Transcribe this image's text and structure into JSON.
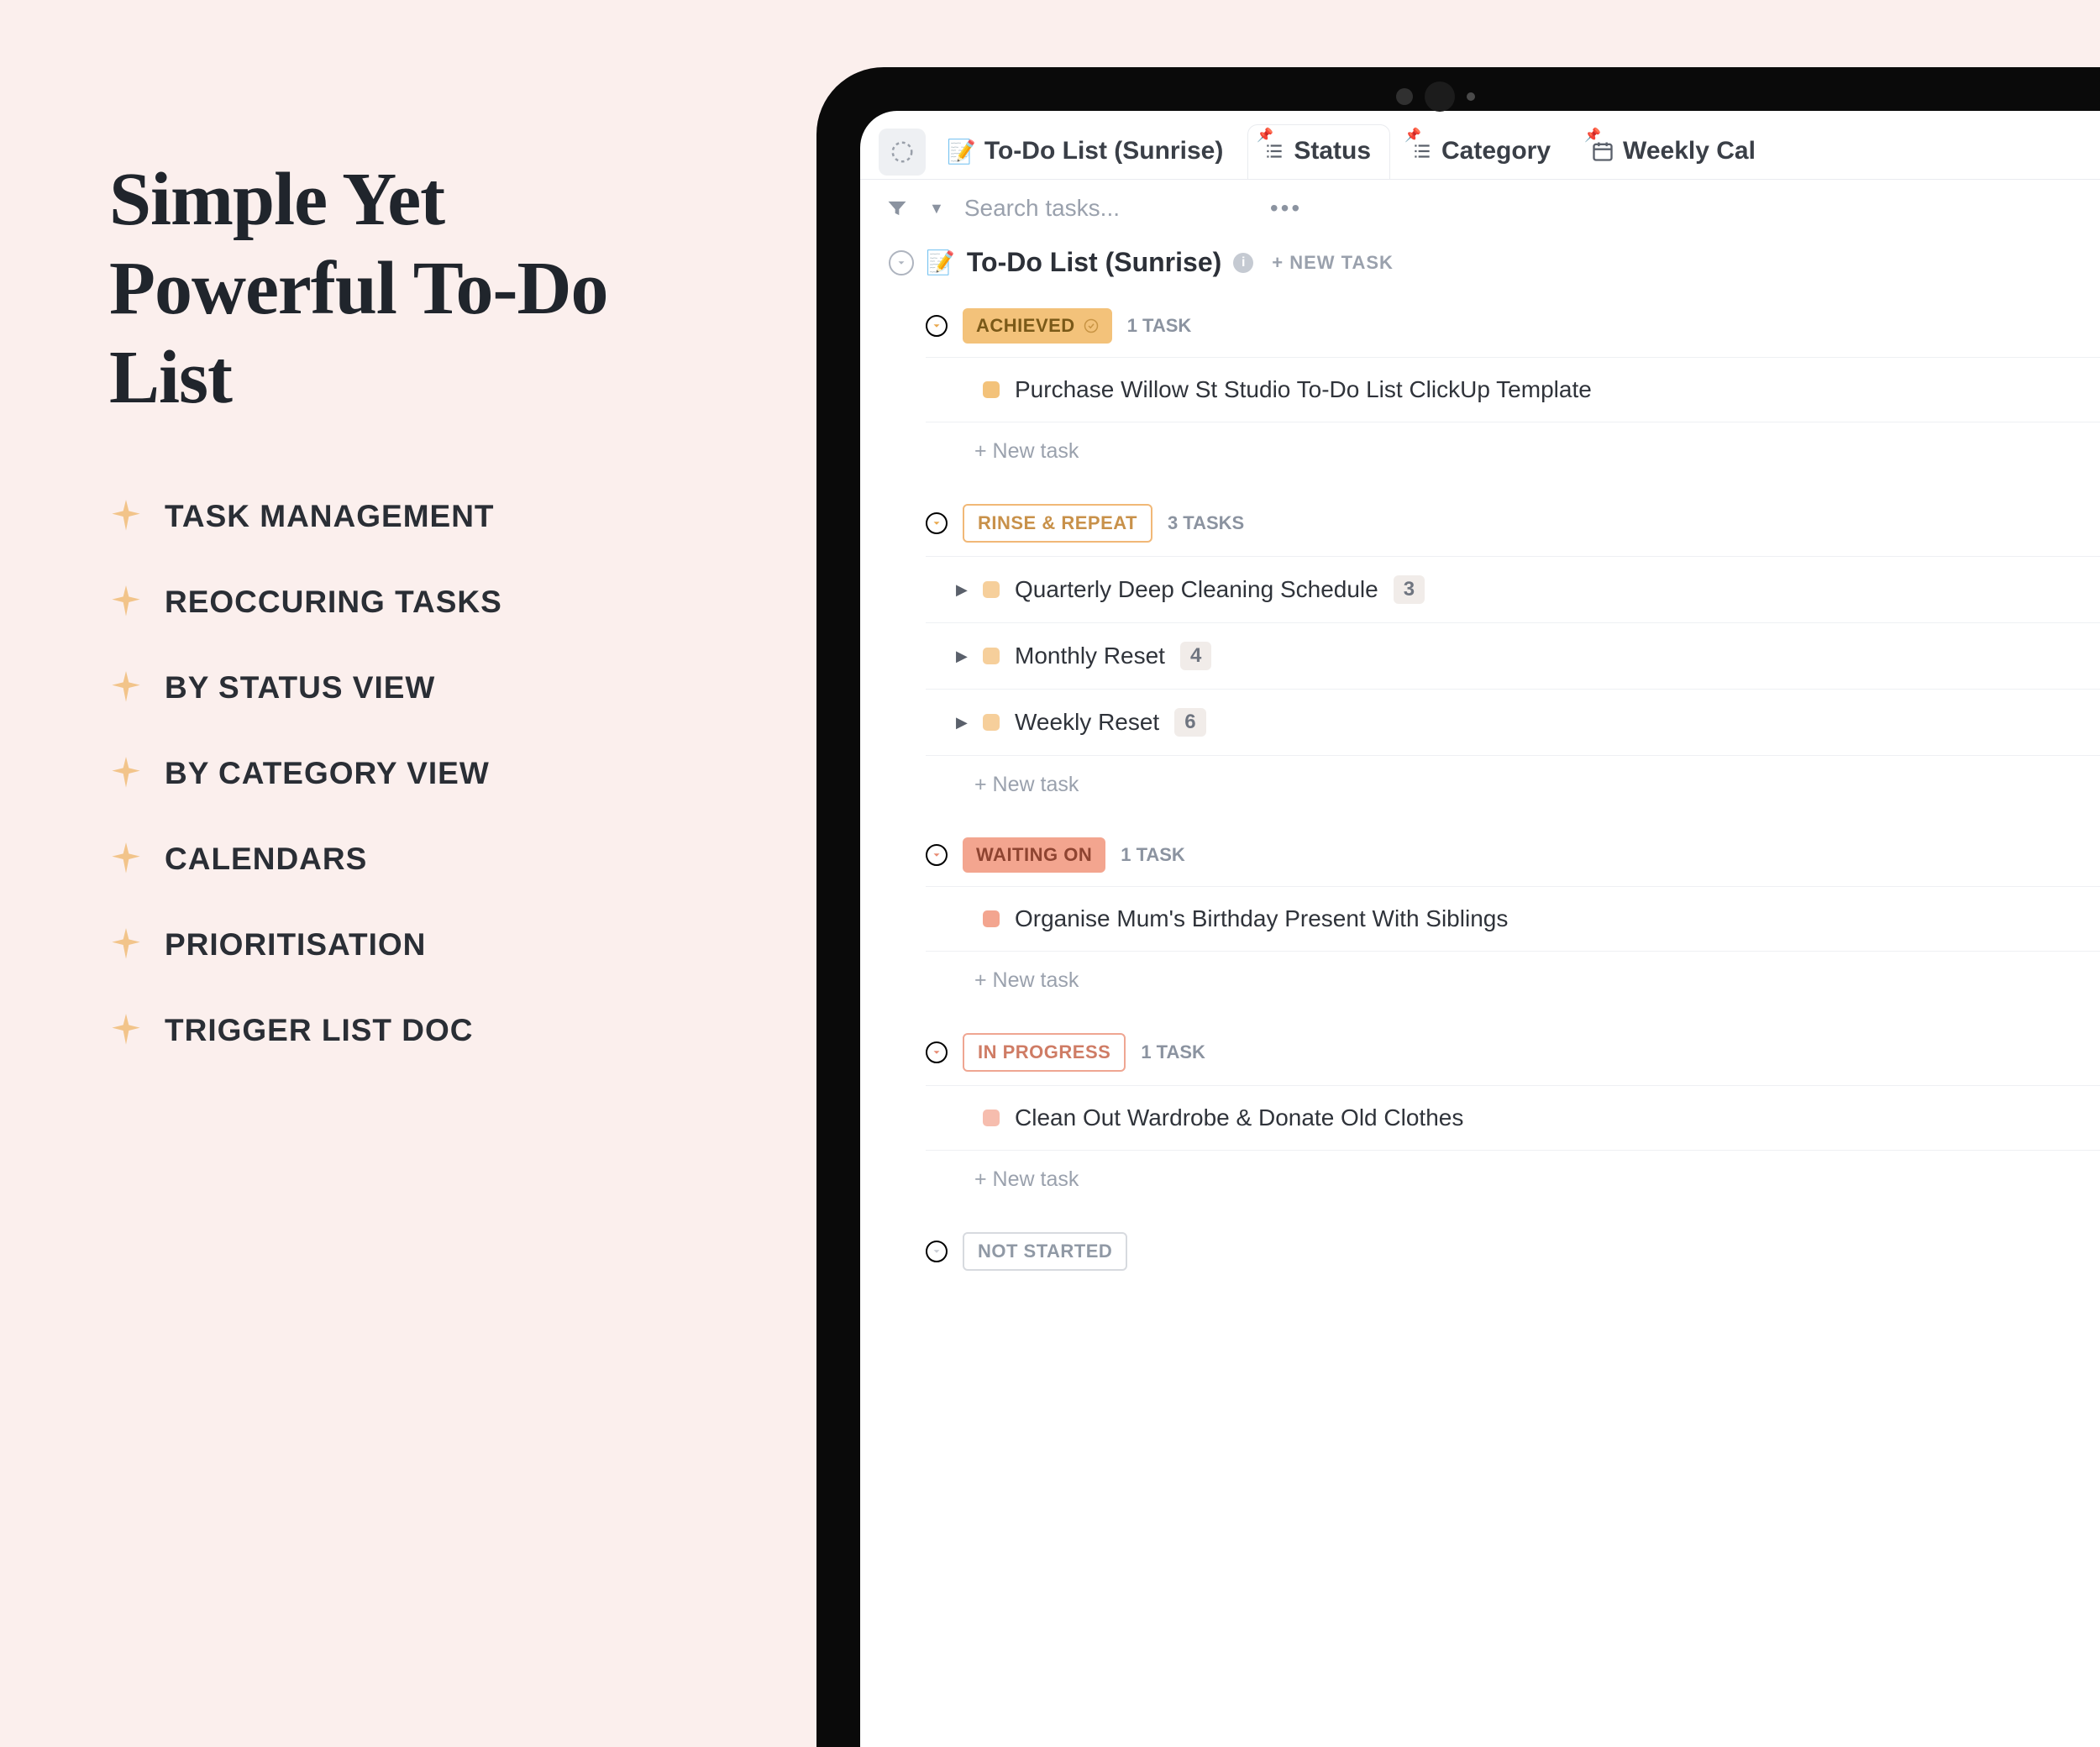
{
  "promo": {
    "headline": "Simple Yet Powerful To-Do List",
    "bullets": [
      "TASK MANAGEMENT",
      "REOCCURING TASKS",
      "BY STATUS VIEW",
      "BY CATEGORY VIEW",
      "CALENDARS",
      "PRIORITISATION",
      "TRIGGER LIST DOC"
    ]
  },
  "tabs": {
    "primary": "To-Do List (Sunrise)",
    "items": [
      "Status",
      "Category",
      "Weekly Cal"
    ]
  },
  "search": {
    "placeholder": "Search tasks..."
  },
  "list": {
    "title": "To-Do List (Sunrise)",
    "new_task_label": "+ NEW TASK"
  },
  "groups": [
    {
      "status": "ACHIEVED",
      "count_label": "1 TASK",
      "theme": "achieved",
      "show_check": true,
      "tasks": [
        {
          "title": "Purchase Willow St Studio To-Do List ClickUp Template",
          "expandable": false
        }
      ],
      "new_task": "+ New task"
    },
    {
      "status": "RINSE & REPEAT",
      "count_label": "3 TASKS",
      "theme": "rinse",
      "show_check": false,
      "tasks": [
        {
          "title": "Quarterly Deep Cleaning Schedule",
          "expandable": true,
          "sub": "3"
        },
        {
          "title": "Monthly Reset",
          "expandable": true,
          "sub": "4"
        },
        {
          "title": "Weekly Reset",
          "expandable": true,
          "sub": "6"
        }
      ],
      "new_task": "+ New task"
    },
    {
      "status": "WAITING ON",
      "count_label": "1 TASK",
      "theme": "waiting",
      "show_check": false,
      "tasks": [
        {
          "title": "Organise Mum's Birthday Present With Siblings",
          "expandable": false
        }
      ],
      "new_task": "+ New task"
    },
    {
      "status": "IN PROGRESS",
      "count_label": "1 TASK",
      "theme": "progress",
      "show_check": false,
      "tasks": [
        {
          "title": "Clean Out Wardrobe & Donate Old Clothes",
          "expandable": false
        }
      ],
      "new_task": "+ New task"
    },
    {
      "status": "NOT STARTED",
      "count_label": "",
      "theme": "notstarted",
      "show_check": false,
      "tasks": [],
      "new_task": ""
    }
  ]
}
